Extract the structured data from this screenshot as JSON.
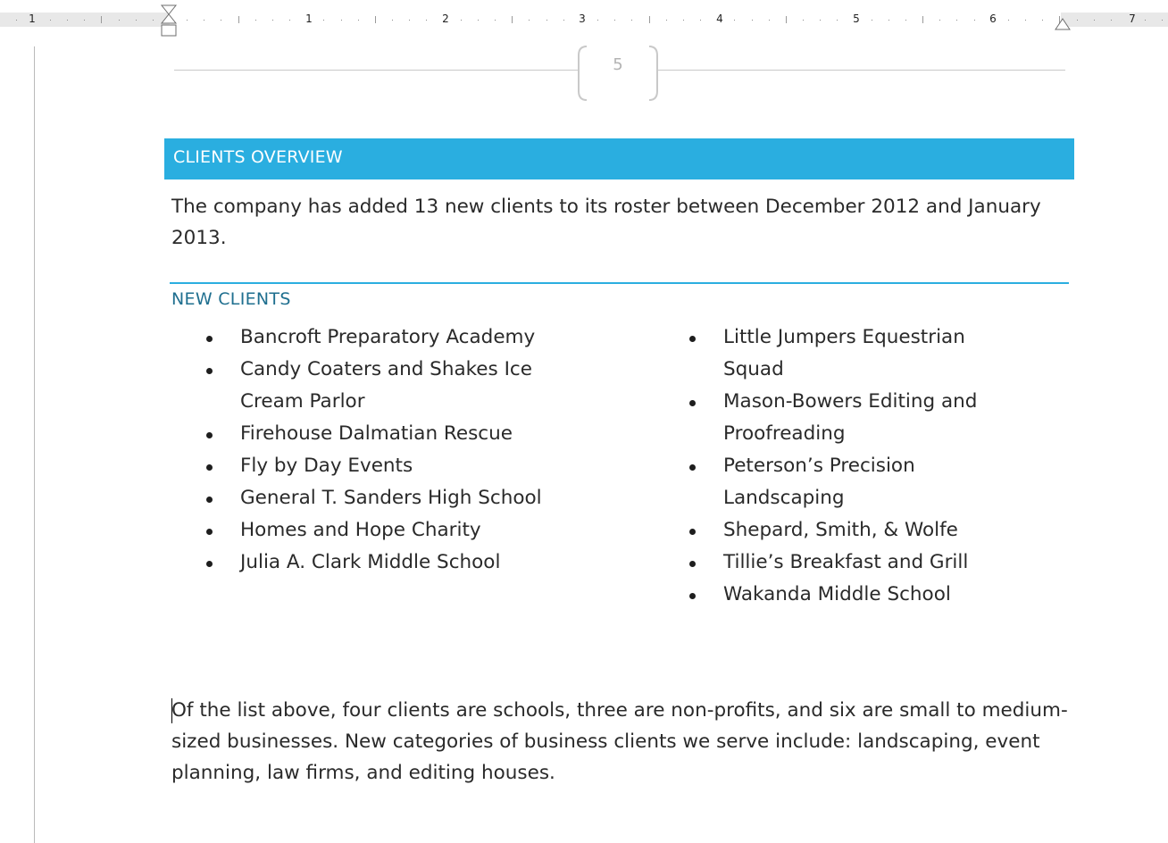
{
  "ruler": {
    "numbers": [
      "1",
      "1",
      "2",
      "3",
      "4",
      "5",
      "6",
      "7"
    ]
  },
  "header": {
    "page_number": "5"
  },
  "section": {
    "title": "CLIENTS OVERVIEW",
    "intro": "The company has added 13 new clients to its roster between December 2012 and January 2013."
  },
  "new_clients": {
    "heading": "NEW CLIENTS",
    "left_column": [
      "Bancroft Preparatory Academy",
      "Candy Coaters and Shakes Ice Cream Parlor",
      "Firehouse Dalmatian Rescue",
      "Fly by Day Events",
      "General T. Sanders High School",
      "Homes and Hope Charity",
      "Julia A. Clark Middle School"
    ],
    "right_column": [
      "Little Jumpers Equestrian Squad",
      "Mason-Bowers Editing and Proofreading",
      "Peterson’s Precision Landscaping",
      "Shepard, Smith, & Wolfe",
      "Tillie’s Breakfast and Grill",
      "Wakanda Middle School"
    ]
  },
  "body": {
    "paragraph": "Of the list above, four clients are schools, three are non-profits, and six are small to medium-sized businesses. New categories of business clients we serve include: landscaping, event planning, law firms, and editing houses."
  },
  "colors": {
    "accent": "#2aaee0",
    "subheading": "#1f6f8f"
  }
}
